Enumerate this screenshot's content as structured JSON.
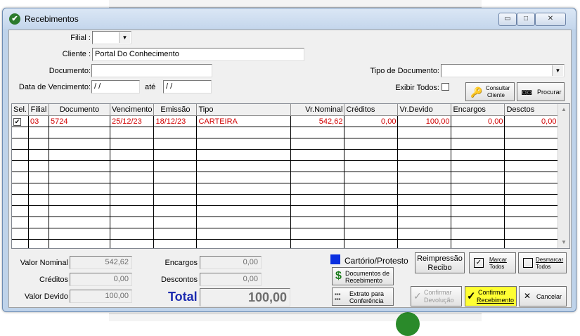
{
  "window": {
    "title": "Recebimentos",
    "minimize": "▭",
    "maximize": "□",
    "close": "✕"
  },
  "filters": {
    "filial_label": "Filial :",
    "filial_value": "",
    "cliente_label": "Cliente :",
    "cliente_value": "Portal Do Conhecimento",
    "documento_label": "Documento:",
    "documento_value": "",
    "vencimento_label": "Data de Vencimento:",
    "vencimento_from": " / /",
    "ate_label": "até",
    "vencimento_to": " / /",
    "tipo_doc_label": "Tipo de Documento:",
    "tipo_doc_value": "",
    "exibir_todos_label": "Exibir Todos:",
    "consultar_cliente_line1": "Consultar",
    "consultar_cliente_line2": "Cliente",
    "procurar_label": "Procurar"
  },
  "grid": {
    "columns": [
      "Sel.",
      "Filial",
      "Documento",
      "Vencimento",
      "Emissão",
      "Tipo",
      "Vr.Nominal",
      "Créditos",
      "Vr.Devido",
      "Encargos",
      "Desctos"
    ],
    "rows": [
      {
        "sel": "✔",
        "filial": "03",
        "documento": "5724",
        "vencimento": "25/12/23",
        "emissao": "18/12/23",
        "tipo": "CARTEIRA",
        "vr_nominal": "542,62",
        "creditos": "0,00",
        "vr_devido": "100,00",
        "encargos": "0,00",
        "desctos": "0,00"
      }
    ]
  },
  "totals": {
    "valor_nominal_label": "Valor Nominal",
    "valor_nominal": "542,62",
    "creditos_label": "Créditos",
    "creditos": "0,00",
    "valor_devido_label": "Valor Devido",
    "valor_devido": "100,00",
    "encargos_label": "Encargos",
    "encargos": "0,00",
    "descontos_label": "Descontos",
    "descontos": "0,00",
    "total_label": "Total",
    "total": "100,00"
  },
  "actions": {
    "cartorio_label": "Cartório/Protesto",
    "cartorio_color": "#0a2fe0",
    "reimpressao_line1": "Reimpressão",
    "reimpressao_line2": "Recibo",
    "marcar_line1": "Marcar",
    "marcar_line2": "Todos",
    "desmarcar_line1": "Desmarcar",
    "desmarcar_line2": "Todos",
    "documentos_line1": "Documentos de",
    "documentos_line2": "Recebimento",
    "extrato_line1": "Extrato para",
    "extrato_line2": "Conferência",
    "confirmar_devolucao_line1": "Confirmar",
    "confirmar_devolucao_line2": "Devolução",
    "confirmar_recebimento_line1": "Confirmar",
    "confirmar_recebimento_line2": "Recebimento",
    "cancelar_label": "Cancelar",
    "highlight_color": "#ffff33"
  }
}
